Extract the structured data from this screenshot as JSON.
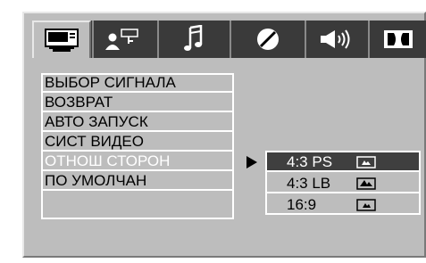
{
  "tabs": [
    {
      "id": "general",
      "icon": "tv-monitor-icon",
      "active": true
    },
    {
      "id": "password",
      "icon": "person-key-icon",
      "active": false
    },
    {
      "id": "audio",
      "icon": "music-note-icon",
      "active": false
    },
    {
      "id": "preferences",
      "icon": "slashed-circle-icon",
      "active": false
    },
    {
      "id": "speaker",
      "icon": "speaker-volume-icon",
      "active": false
    },
    {
      "id": "dolby",
      "icon": "dolby-dd-icon",
      "active": false
    }
  ],
  "menu": {
    "items": [
      {
        "label": "ВЫБОР СИГНАЛА"
      },
      {
        "label": "ВОЗВРАТ"
      },
      {
        "label": "АВТО ЗАПУСК"
      },
      {
        "label": "СИСТ ВИДЕО"
      },
      {
        "label": "ОТНОШ СТОРОН",
        "selected": true
      },
      {
        "label": "ПО УМОЛЧАН"
      },
      {
        "label": ""
      }
    ]
  },
  "submenu": {
    "items": [
      {
        "label": "4:3 PS",
        "icon": "pan-scan-aspect-icon",
        "selected": true
      },
      {
        "label": "4:3 LB",
        "icon": "letterbox-aspect-icon",
        "selected": false
      },
      {
        "label": "16:9",
        "icon": "widescreen-aspect-icon",
        "selected": false
      }
    ]
  },
  "colors": {
    "panel_bg": "#bdbdbd",
    "tabbar_bg": "#3a3a3a",
    "selected_row_bg": "#3f3f3f",
    "selected_text": "#ffffff",
    "text": "#000000"
  }
}
